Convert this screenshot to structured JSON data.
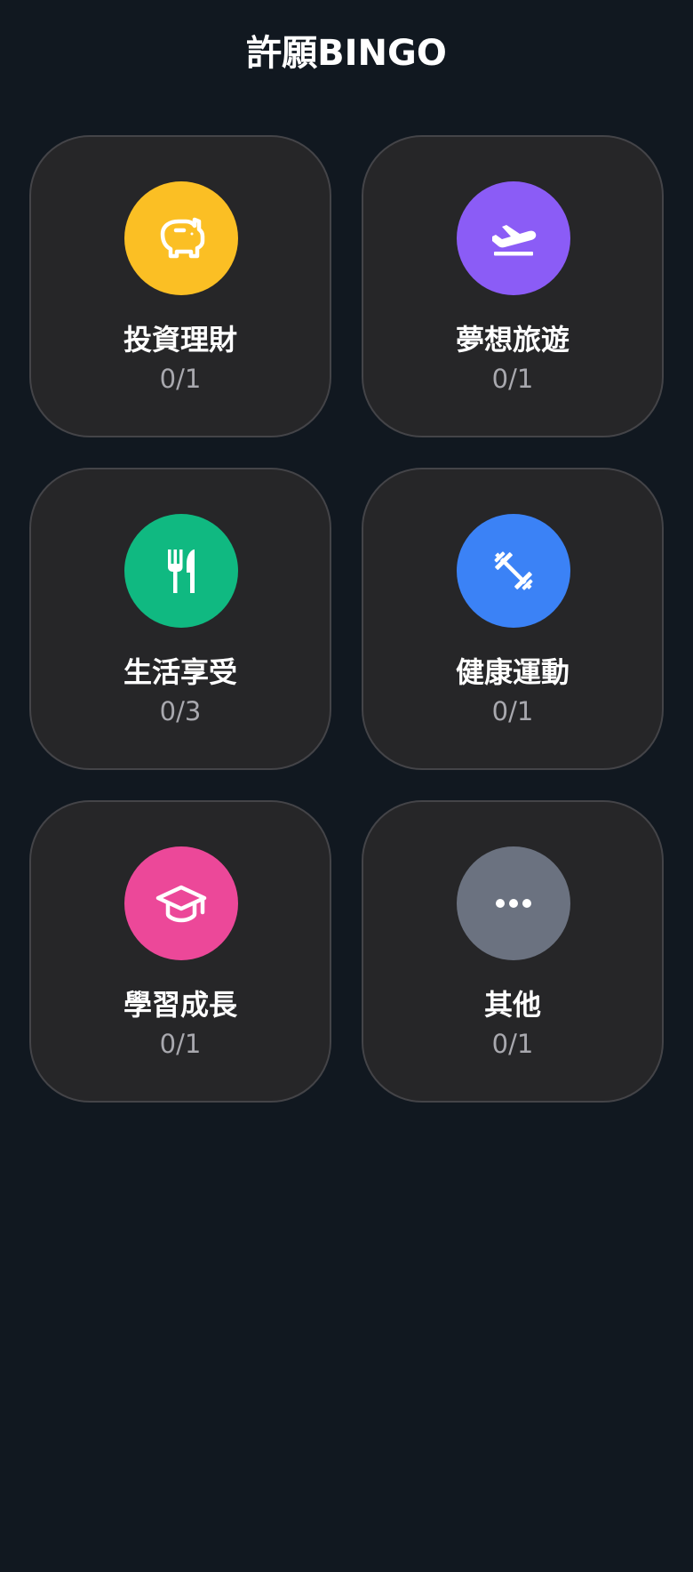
{
  "page": {
    "title": "許願BINGO"
  },
  "categories": [
    {
      "label": "投資理財",
      "count": "0/1",
      "icon": "piggy-bank-icon",
      "color": "#FBBF24"
    },
    {
      "label": "夢想旅遊",
      "count": "0/1",
      "icon": "airplane-takeoff-icon",
      "color": "#8B5CF6"
    },
    {
      "label": "生活享受",
      "count": "0/3",
      "icon": "fork-knife-icon",
      "color": "#10B981"
    },
    {
      "label": "健康運動",
      "count": "0/1",
      "icon": "dumbbell-icon",
      "color": "#3B82F6"
    },
    {
      "label": "學習成長",
      "count": "0/1",
      "icon": "graduation-cap-icon",
      "color": "#EC4899"
    },
    {
      "label": "其他",
      "count": "0/1",
      "icon": "more-dots-icon",
      "color": "#6B7280"
    }
  ]
}
